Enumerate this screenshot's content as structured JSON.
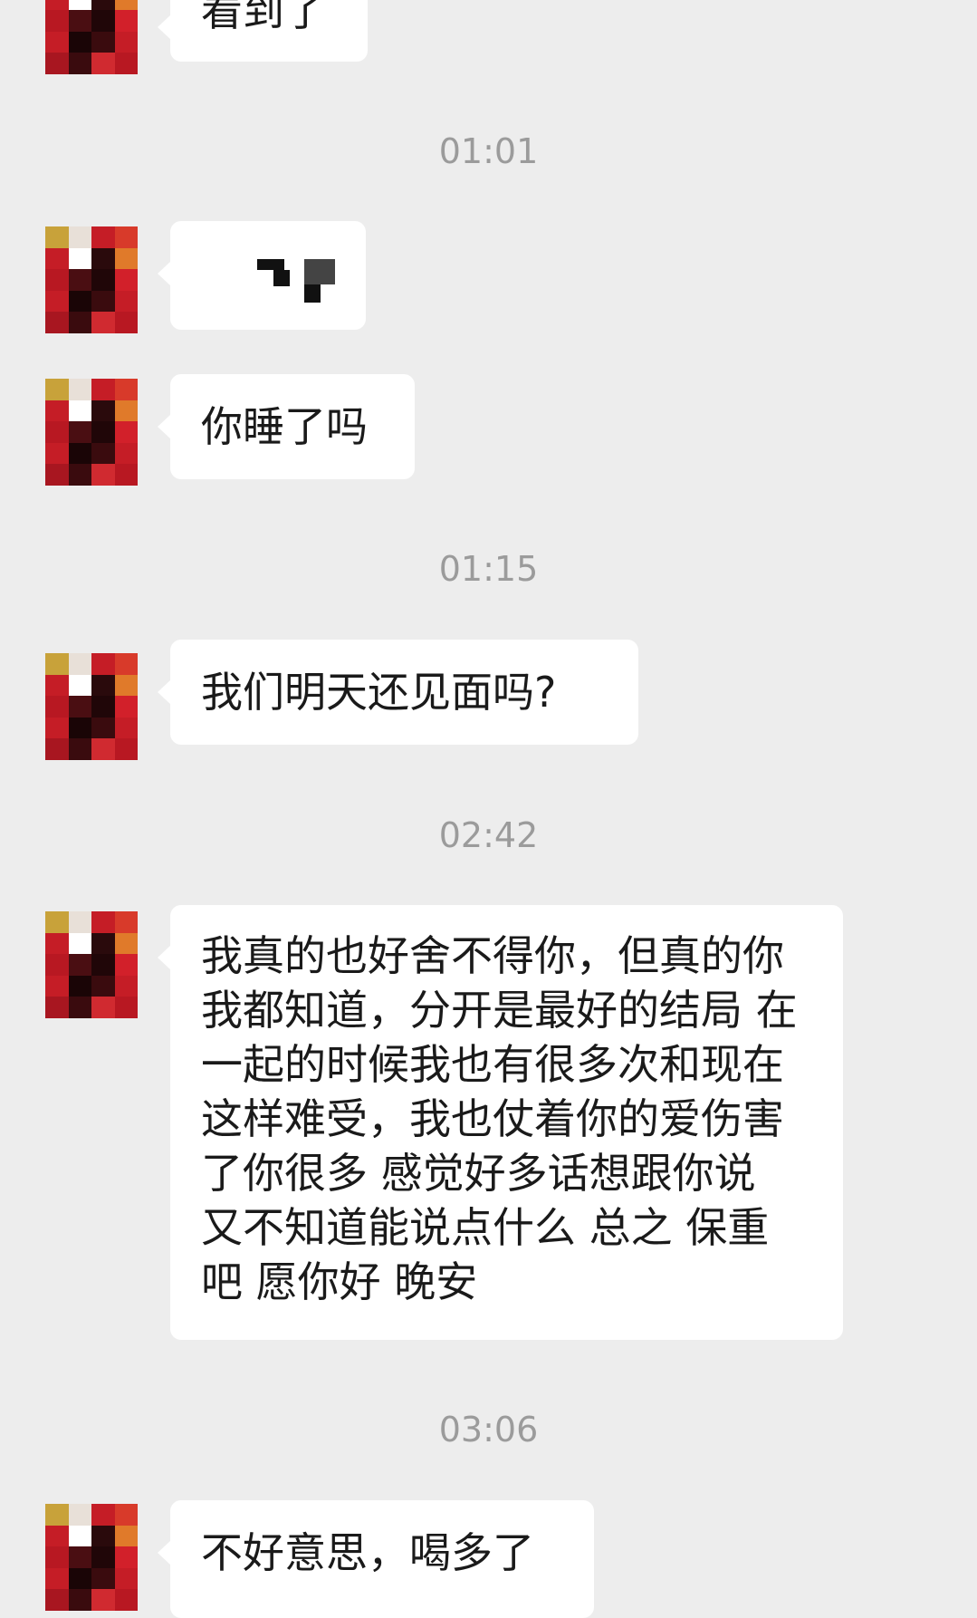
{
  "messages": [
    {
      "text": "看到了"
    },
    {
      "emoji_name": "pixelated-emoji-sticker"
    },
    {
      "text": "你睡了吗"
    },
    {
      "text": "我们明天还见面吗?"
    },
    {
      "text": "我真的也好舍不得你，但真的你我都知道，分开是最好的结局 在一起的时候我也有很多次和现在这样难受，我也仗着你的爱伤害了你很多 感觉好多话想跟你说 又不知道能说点什么 总之 保重吧 愿你好 晚安"
    },
    {
      "text": "不好意思，喝多了"
    }
  ],
  "timestamps": [
    "01:01",
    "01:15",
    "02:42",
    "03:06"
  ],
  "colors": {
    "background": "#ededed",
    "bubble": "#ffffff",
    "timestamp": "#9b9b9b",
    "avatar_red": "#d0202a",
    "avatar_dark": "#3a0b0e"
  },
  "icons": {
    "avatar": "pixelated-avatar-icon"
  }
}
